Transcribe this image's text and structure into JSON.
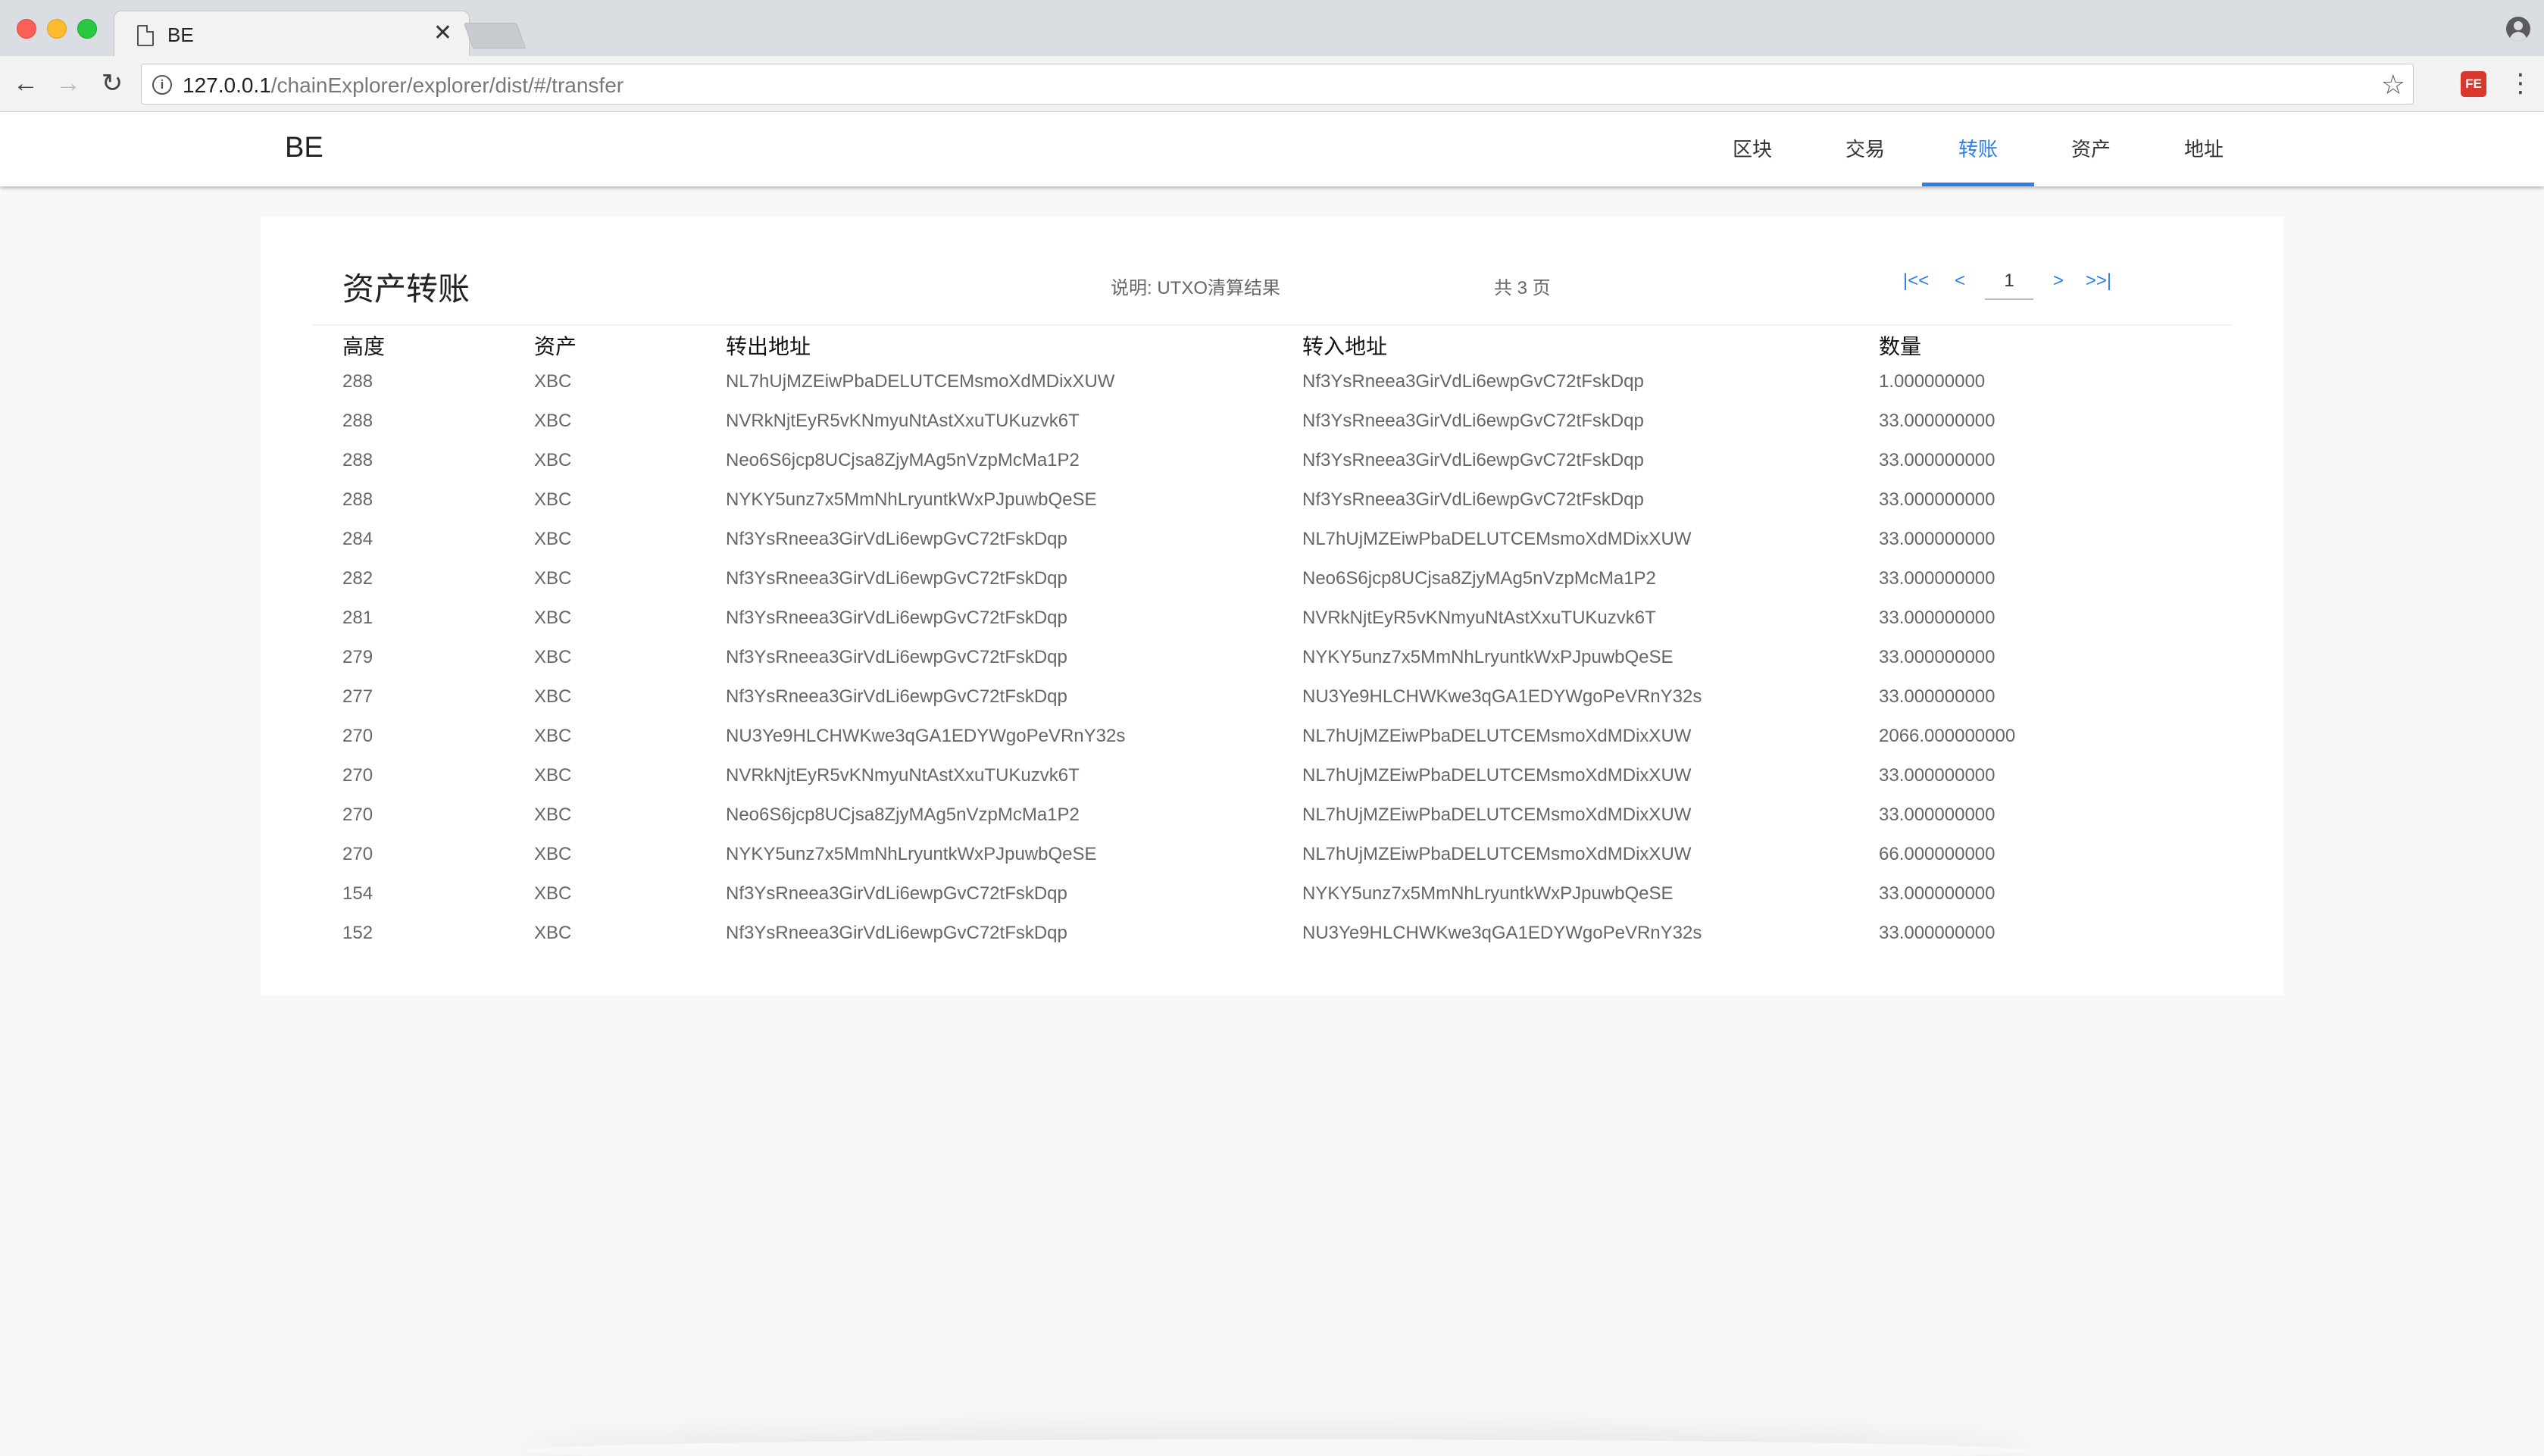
{
  "browser": {
    "tab_title": "BE",
    "tab_close": "✕",
    "url_host": "127.0.0.1",
    "url_path": "/chainExplorer/explorer/dist/#/transfer",
    "extension_label": "FE"
  },
  "header": {
    "brand": "BE",
    "nav": [
      "区块",
      "交易",
      "转账",
      "资产",
      "地址"
    ],
    "active_nav": "转账"
  },
  "main": {
    "title": "资产转账",
    "note": "说明: UTXO清算结果",
    "page_total": "共 3 页",
    "pagination": {
      "first": "|<<",
      "prev": "<",
      "current": "1",
      "next": ">",
      "last": ">>|"
    },
    "columns": [
      "高度",
      "资产",
      "转出地址",
      "转入地址",
      "数量"
    ],
    "rows": [
      [
        "288",
        "XBC",
        "NL7hUjMZEiwPbaDELUTCEMsmoXdMDixXUW",
        "Nf3YsRneea3GirVdLi6ewpGvC72tFskDqp",
        "1.000000000"
      ],
      [
        "288",
        "XBC",
        "NVRkNjtEyR5vKNmyuNtAstXxuTUKuzvk6T",
        "Nf3YsRneea3GirVdLi6ewpGvC72tFskDqp",
        "33.000000000"
      ],
      [
        "288",
        "XBC",
        "Neo6S6jcp8UCjsa8ZjyMAg5nVzpMcMa1P2",
        "Nf3YsRneea3GirVdLi6ewpGvC72tFskDqp",
        "33.000000000"
      ],
      [
        "288",
        "XBC",
        "NYKY5unz7x5MmNhLryuntkWxPJpuwbQeSE",
        "Nf3YsRneea3GirVdLi6ewpGvC72tFskDqp",
        "33.000000000"
      ],
      [
        "284",
        "XBC",
        "Nf3YsRneea3GirVdLi6ewpGvC72tFskDqp",
        "NL7hUjMZEiwPbaDELUTCEMsmoXdMDixXUW",
        "33.000000000"
      ],
      [
        "282",
        "XBC",
        "Nf3YsRneea3GirVdLi6ewpGvC72tFskDqp",
        "Neo6S6jcp8UCjsa8ZjyMAg5nVzpMcMa1P2",
        "33.000000000"
      ],
      [
        "281",
        "XBC",
        "Nf3YsRneea3GirVdLi6ewpGvC72tFskDqp",
        "NVRkNjtEyR5vKNmyuNtAstXxuTUKuzvk6T",
        "33.000000000"
      ],
      [
        "279",
        "XBC",
        "Nf3YsRneea3GirVdLi6ewpGvC72tFskDqp",
        "NYKY5unz7x5MmNhLryuntkWxPJpuwbQeSE",
        "33.000000000"
      ],
      [
        "277",
        "XBC",
        "Nf3YsRneea3GirVdLi6ewpGvC72tFskDqp",
        "NU3Ye9HLCHWKwe3qGA1EDYWgoPeVRnY32s",
        "33.000000000"
      ],
      [
        "270",
        "XBC",
        "NU3Ye9HLCHWKwe3qGA1EDYWgoPeVRnY32s",
        "NL7hUjMZEiwPbaDELUTCEMsmoXdMDixXUW",
        "2066.000000000"
      ],
      [
        "270",
        "XBC",
        "NVRkNjtEyR5vKNmyuNtAstXxuTUKuzvk6T",
        "NL7hUjMZEiwPbaDELUTCEMsmoXdMDixXUW",
        "33.000000000"
      ],
      [
        "270",
        "XBC",
        "Neo6S6jcp8UCjsa8ZjyMAg5nVzpMcMa1P2",
        "NL7hUjMZEiwPbaDELUTCEMsmoXdMDixXUW",
        "33.000000000"
      ],
      [
        "270",
        "XBC",
        "NYKY5unz7x5MmNhLryuntkWxPJpuwbQeSE",
        "NL7hUjMZEiwPbaDELUTCEMsmoXdMDixXUW",
        "66.000000000"
      ],
      [
        "154",
        "XBC",
        "Nf3YsRneea3GirVdLi6ewpGvC72tFskDqp",
        "NYKY5unz7x5MmNhLryuntkWxPJpuwbQeSE",
        "33.000000000"
      ],
      [
        "152",
        "XBC",
        "Nf3YsRneea3GirVdLi6ewpGvC72tFskDqp",
        "NU3Ye9HLCHWKwe3qGA1EDYWgoPeVRnY32s",
        "33.000000000"
      ]
    ]
  },
  "colors": {
    "accent": "#2d7ee8",
    "page_bg": "#f8f8f8",
    "card_bg": "#ffffff",
    "text_muted": "#666666"
  }
}
